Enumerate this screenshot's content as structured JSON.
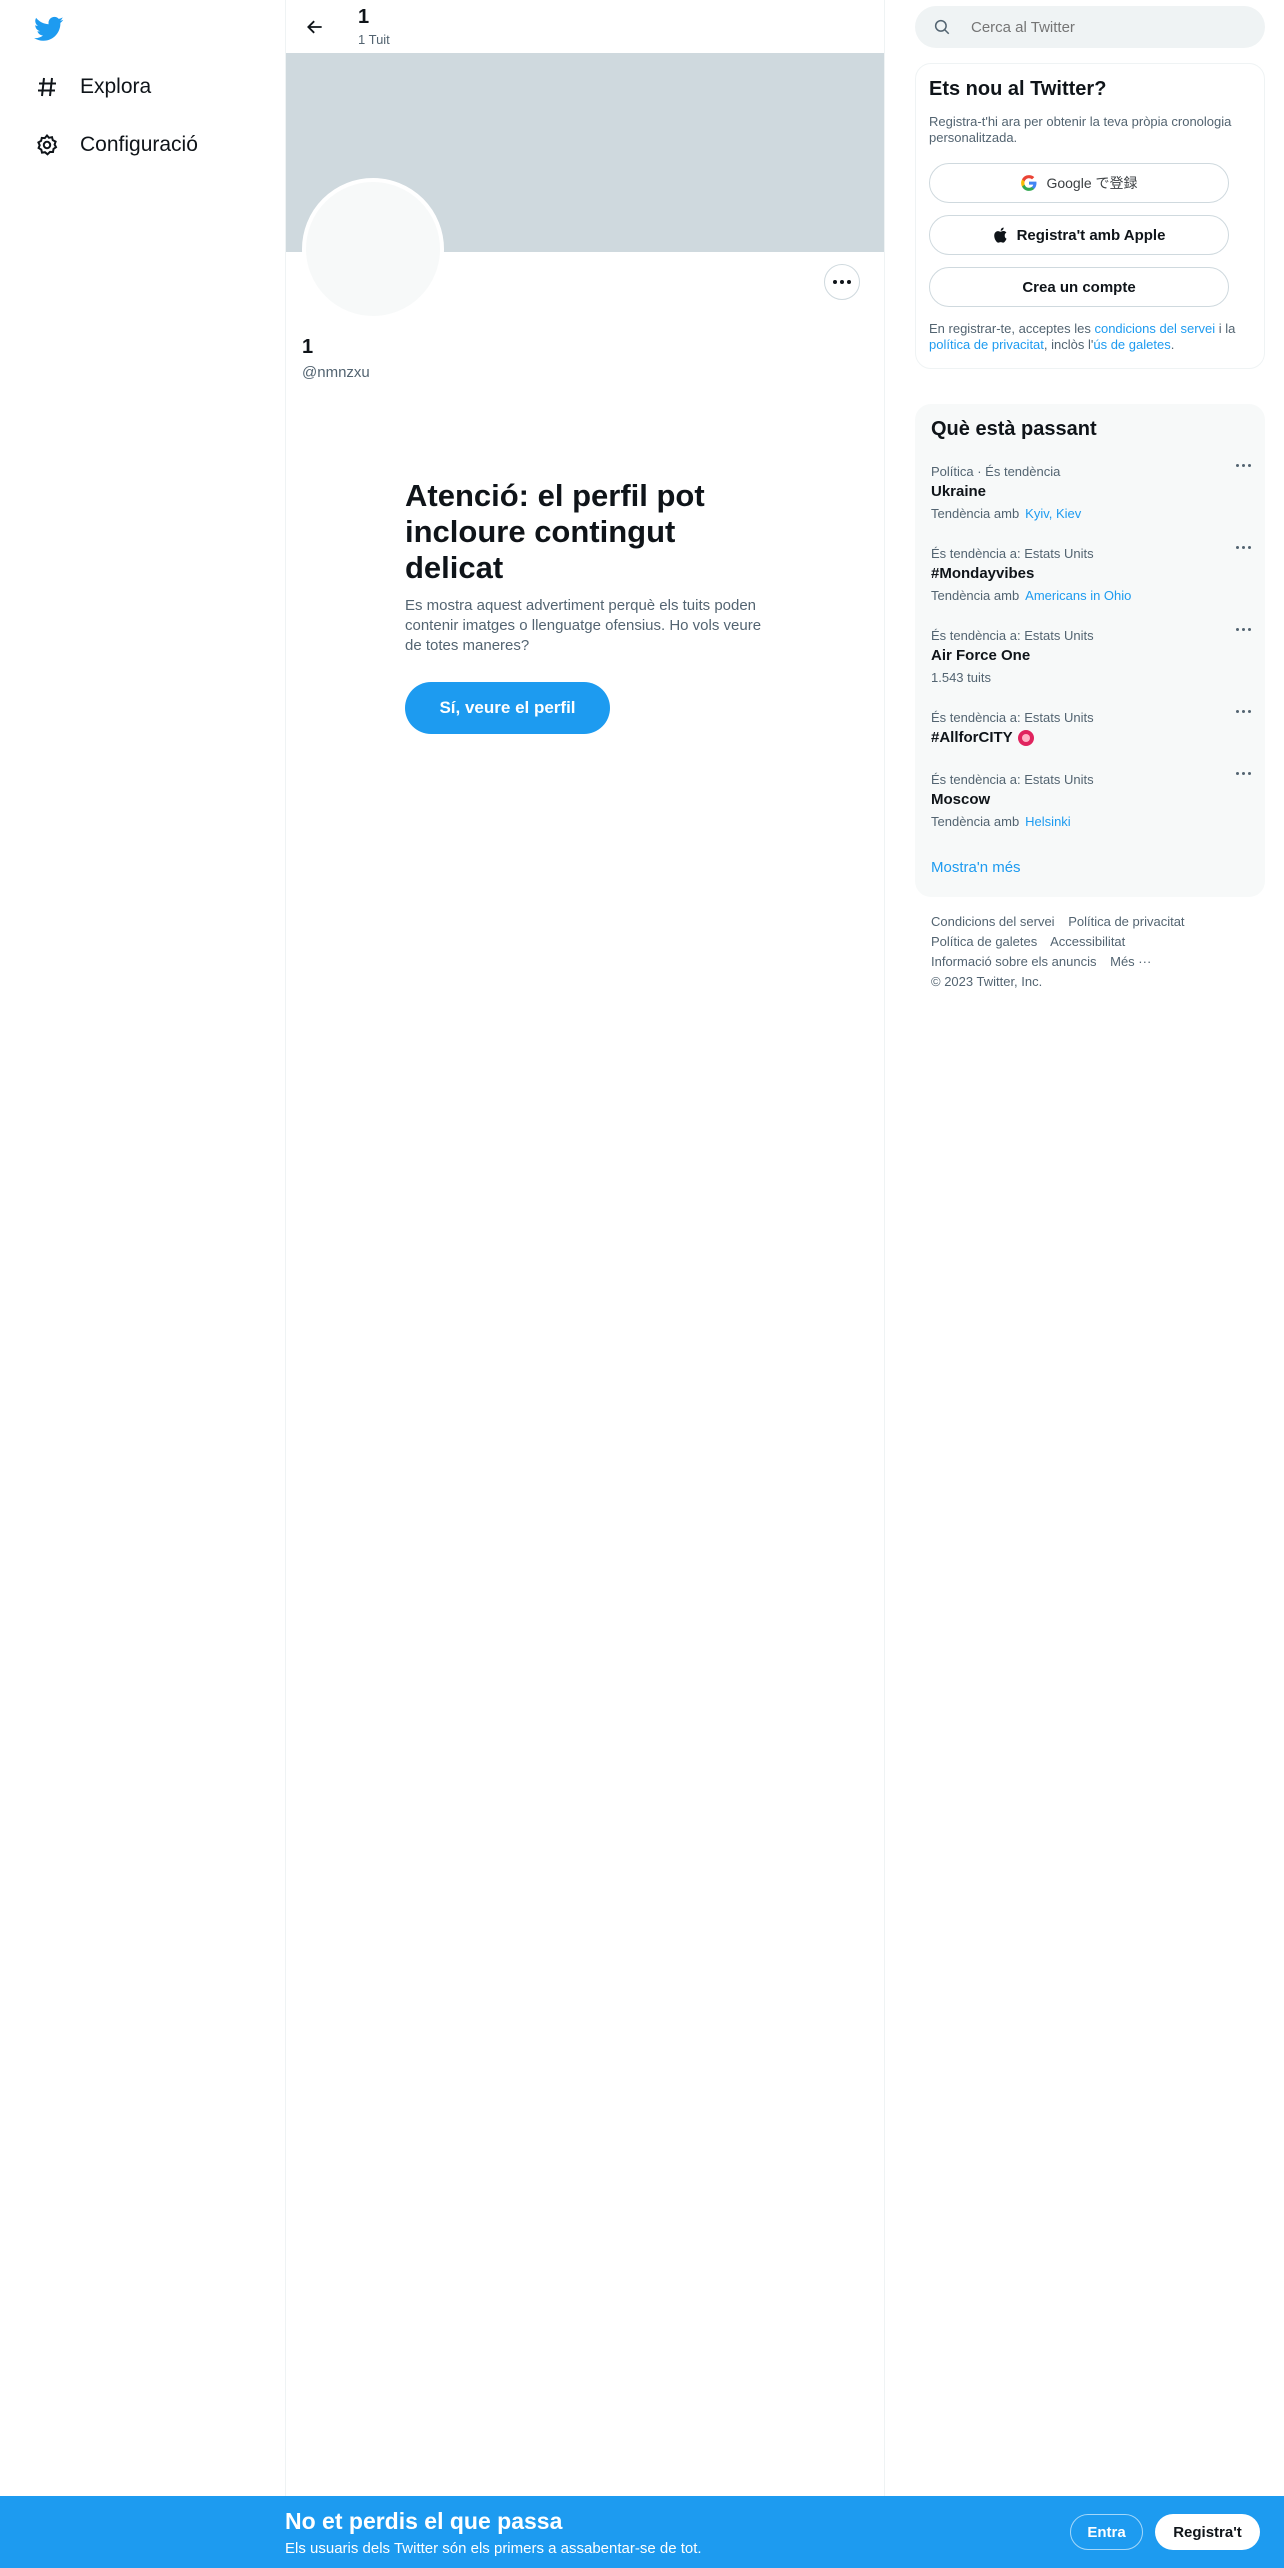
{
  "nav": {
    "logo": "twitter-bird-icon",
    "items": [
      {
        "label": "Explora",
        "icon": "hashtag-icon"
      },
      {
        "label": "Configuració",
        "icon": "gear-icon"
      }
    ]
  },
  "header": {
    "title": "1",
    "subtitle": "1 Tuit"
  },
  "profile": {
    "name": "1",
    "handle": "@nmnzxu"
  },
  "warning": {
    "title": "Atenció: el perfil pot incloure contingut delicat",
    "body": "Es mostra aquest advertiment perquè els tuits poden contenir imatges o llenguatge ofensius. Ho vols veure de totes maneres?",
    "button": "Sí, veure el perfil"
  },
  "search": {
    "placeholder": "Cerca al Twitter"
  },
  "signup": {
    "title": "Ets nou al Twitter?",
    "description": "Registra-t'hi ara per obtenir la teva pròpia cronologia personalitzada.",
    "google_label": "Google で登録",
    "apple_label": "Registra't amb Apple",
    "create_label": "Crea un compte",
    "terms_prefix": "En registrar-te, acceptes les ",
    "terms_link": "condicions del servei",
    "terms_mid": " i la ",
    "privacy_link": "política de privacitat",
    "terms_mid2": ", inclòs l'",
    "cookies_link": "ús de galetes",
    "terms_end": "."
  },
  "trends": {
    "title": "Què està passant",
    "items": [
      {
        "meta": "Política · És tendència",
        "name": "Ukraine",
        "sub_prefix": "Tendència amb",
        "sub_link": "Kyiv, Kiev"
      },
      {
        "meta": "És tendència a: Estats Units",
        "name": "#Mondayvibes",
        "sub_prefix": "Tendència amb",
        "sub_link": "Americans in Ohio"
      },
      {
        "meta": "És tendència a: Estats Units",
        "name": "Air Force One",
        "sub_prefix": "1.543 tuits",
        "sub_link": ""
      },
      {
        "meta": "És tendència a: Estats Units",
        "name": "#AllforCITY",
        "sub_prefix": "",
        "sub_link": ""
      },
      {
        "meta": "És tendència a: Estats Units",
        "name": "Moscow",
        "sub_prefix": "Tendència amb",
        "sub_link": "Helsinki"
      }
    ],
    "show_more": "Mostra'n més"
  },
  "footer": {
    "links": [
      "Condicions del servei",
      "Política de privacitat",
      "Política de galetes",
      "Accessibilitat",
      "Informació sobre els anuncis",
      "Més ···"
    ],
    "copyright": "© 2023 Twitter, Inc."
  },
  "bottom_bar": {
    "title": "No et perdis el que passa",
    "subtitle": "Els usuaris dels Twitter són els primers a assabentar-se de tot.",
    "login": "Entra",
    "signup": "Registra't"
  },
  "colors": {
    "accent": "#1d9bf0",
    "banner": "#cfd9de"
  }
}
